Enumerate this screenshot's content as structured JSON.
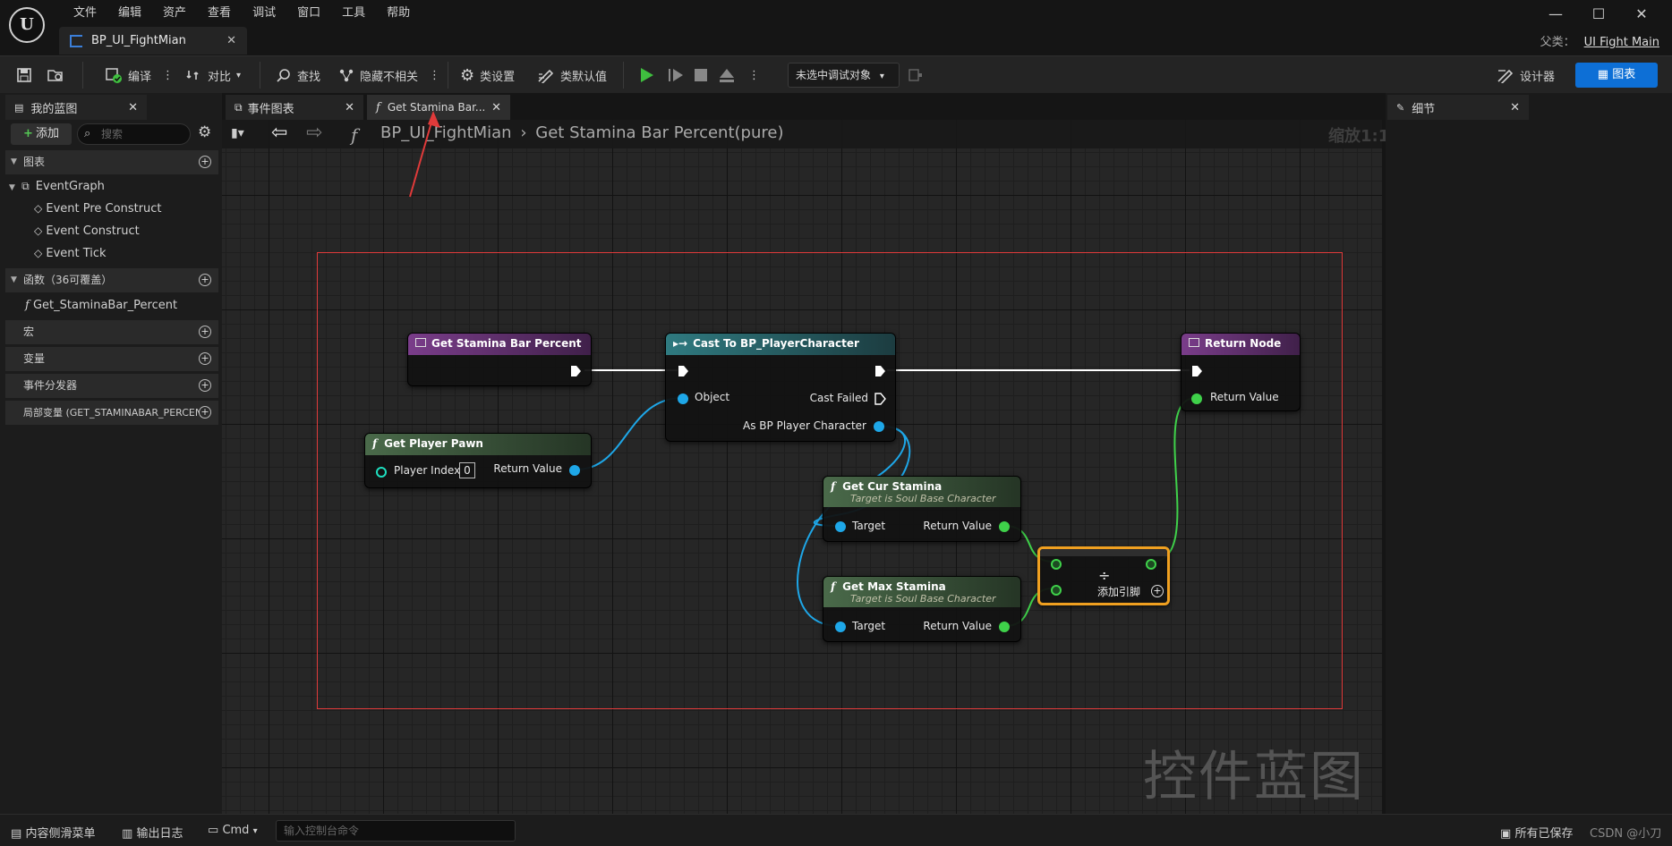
{
  "menu": [
    "文件",
    "编辑",
    "资产",
    "查看",
    "调试",
    "窗口",
    "工具",
    "帮助"
  ],
  "window_controls": {
    "minimize": "—",
    "maximize": "☐",
    "close": "✕"
  },
  "doc_tab": {
    "title": "BP_UI_FightMian"
  },
  "parent": {
    "label": "父类：",
    "link": "UI Fight Main"
  },
  "toolbar": {
    "compile": "编译",
    "diff": "对比",
    "find": "查找",
    "hide_unrelated": "隐藏不相关",
    "class_settings": "类设置",
    "class_defaults": "类默认值",
    "debug_object": "未选中调试对象",
    "designer": "设计器",
    "graph": "图表"
  },
  "my_blueprint": {
    "tab": "我的蓝图",
    "add": "添加",
    "search_placeholder": "搜索",
    "sections": {
      "graphs": "图表",
      "functions": "函数（36可覆盖）",
      "macros": "宏",
      "variables": "变量",
      "dispatchers": "事件分发器",
      "local_vars": "局部变量 (GET_STAMINABAR_PERCEN"
    },
    "graph_items": [
      "EventGraph",
      "Event Pre Construct",
      "Event Construct",
      "Event Tick"
    ],
    "function_items": [
      "Get_StaminaBar_Percent"
    ]
  },
  "graph_tabs": [
    "事件图表",
    "Get Stamina Bar..."
  ],
  "breadcrumb": {
    "root": "BP_UI_FightMian",
    "current": "Get Stamina Bar Percent(pure)"
  },
  "zoom": "缩放1:1",
  "watermark": "控件蓝图",
  "details": {
    "tab": "细节"
  },
  "nodes": {
    "entry": {
      "title": "Get Stamina Bar Percent"
    },
    "cast": {
      "title": "Cast To BP_PlayerCharacter",
      "object": "Object",
      "cast_failed": "Cast Failed",
      "as_bp": "As BP Player Character"
    },
    "return": {
      "title": "Return Node",
      "return_value": "Return Value"
    },
    "pawn": {
      "title": "Get Player Pawn",
      "player_index": "Player Index",
      "index_value": "0",
      "return_value": "Return Value"
    },
    "cur": {
      "title": "Get Cur Stamina",
      "subtitle": "Target is Soul Base Character",
      "target": "Target",
      "return_value": "Return Value"
    },
    "max": {
      "title": "Get Max Stamina",
      "subtitle": "Target is Soul Base Character",
      "target": "Target",
      "return_value": "Return Value"
    },
    "divide": {
      "symbol": "÷",
      "add_pin": "添加引脚"
    }
  },
  "status": {
    "content_drawer": "内容侧滑菜单",
    "output_log": "输出日志",
    "cmd": "Cmd",
    "console_placeholder": "输入控制台命令",
    "saved": "所有已保存",
    "watermark_text": "CSDN @小刀"
  },
  "colors": {
    "accent": "#0d6fd6",
    "exec": "#ffffff",
    "object_pin": "#1ea7e8",
    "float_pin": "#3fd14a",
    "func_header": "#7a3d8a",
    "cast_header": "#2f7a80",
    "pure_header": "#4a6a4a",
    "selection": "#f0a020",
    "highlight_rect": "#e03a3a"
  }
}
